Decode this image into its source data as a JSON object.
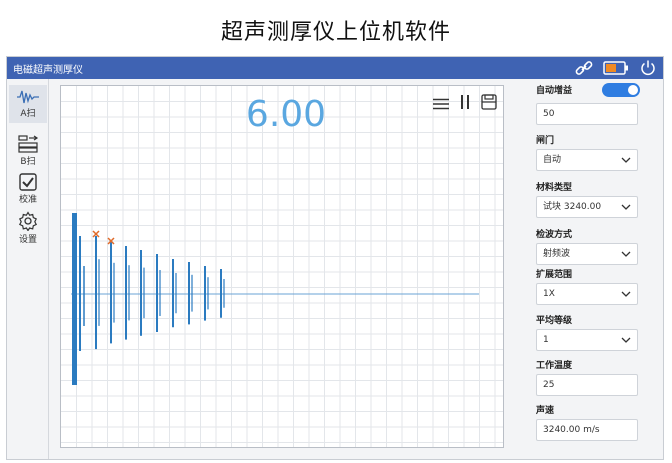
{
  "page_caption": "超声测厚仪上位机软件",
  "app": {
    "title": "电磁超声测厚仪",
    "icons": [
      "link-icon",
      "battery-icon",
      "power-icon"
    ],
    "accent_color": "#3f63b3",
    "battery_color": "#f08a24"
  },
  "sidebar": {
    "items": [
      {
        "label": "A扫",
        "icon": "a-scan-icon",
        "active": true
      },
      {
        "label": "B扫",
        "icon": "b-scan-icon",
        "active": false
      },
      {
        "label": "校准",
        "icon": "check-icon",
        "active": false
      },
      {
        "label": "设置",
        "icon": "gear-icon",
        "active": false
      }
    ]
  },
  "display": {
    "thickness_value": "6.00",
    "value_color": "#5aa7e0",
    "tools": [
      "menu-icon",
      "pause-icon",
      "save-icon"
    ]
  },
  "panel": {
    "auto_gain": {
      "label": "自动增益",
      "on": true
    },
    "gain_value": "50",
    "gate": {
      "label": "闸门",
      "value": "自动"
    },
    "material": {
      "label": "材料类型",
      "value": "试块 3240.00"
    },
    "detect_mode": {
      "label": "检波方式",
      "value": "射频波"
    },
    "range": {
      "label": "扩展范围",
      "value": "1X"
    },
    "average": {
      "label": "平均等级",
      "value": "1"
    },
    "temperature": {
      "label": "工作温度",
      "value": "25"
    },
    "velocity": {
      "label": "声速",
      "value": "3240.00 m/s"
    }
  }
}
